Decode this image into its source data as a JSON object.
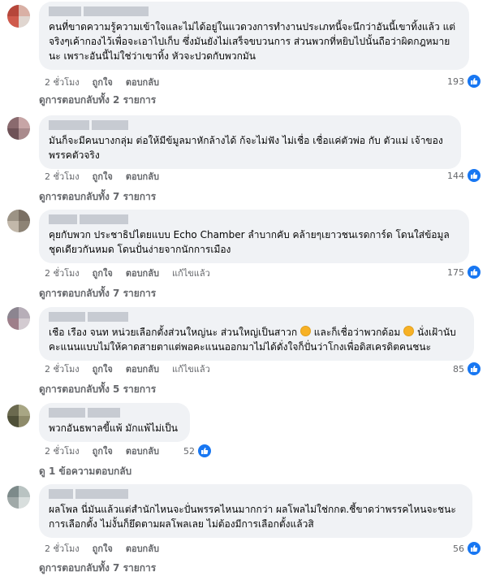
{
  "colors": {
    "accent": "#1877f2",
    "bubble": "#f0f2f5",
    "meta": "#65676b"
  },
  "comments": [
    {
      "text": "คนที่ขาดความรู้ความเข้าใจและไม่ได้อยู่ในแวดวงการทำงานประเภทนี้จะนึกว่าอันนี้เขาทิ้งแล้ว แต่จริงๆเค้ากองไว้เพื่อจะเอาไปเก็บ ซึ่งมันยังไม่เสร็จขบวนการ ส่วนพวกที่หยิบไปนั้นถือว่าผิดกฎหมายนะ เพราะอันนี้ไม่ใช่ว่าเขาทิ้ง หัวจะปวดกับพวกมัน",
      "time": "2 ชั่วโมง",
      "like": "ถูกใจ",
      "reply": "ตอบกลับ",
      "edited": "",
      "reactions": "193",
      "replies": "ดูการตอบกลับทั้ง 2 รายการ"
    },
    {
      "text": "มันก็จะมีคนบางกลุ่ม ต่อให้มีข้มูลมาหักล้างได้ ก้จะไม่ฟัง ไม่เชื่อ เชื่อแค่ตัวพ่อ กับ ตัวแม่ เจ้าของพรรคตัวจริง",
      "time": "2 ชั่วโมง",
      "like": "ถูกใจ",
      "reply": "ตอบกลับ",
      "edited": "",
      "reactions": "144",
      "replies": "ดูการตอบกลับทั้ง 7 รายการ"
    },
    {
      "text": "คุยกับพวก ประชาธิปไตยแบบ Echo Chamber ลำบากคับ คล้ายๆเยาวชนเรดการ์ด โดนใส่ข้อมูลชุดเดียวกันหมด โดนปั่นง่ายจากนักการเมือง",
      "time": "2 ชั่วโมง",
      "like": "ถูกใจ",
      "reply": "ตอบกลับ",
      "edited": "แก้ไขแล้ว",
      "reactions": "175",
      "replies": "ดูการตอบกลับทั้ง 7 รายการ"
    },
    {
      "text_a": "เชือ เรือง จนท หน่วยเลือกตั้งส่วนใหญ่นะ ส่วนใหญ่เป็นสาวก",
      "text_b": "และก็เชื่อว่าพวกด้อม",
      "text_c": "นั่งเฝ้านับคะแนนแบบไม่ให้คาดสายตาแต่พอคะแนนออกมาไม่ได้ดั่งใจก็ปั่นว่าโกงเพื่อดิสเครดิตคนชนะ",
      "time": "2 ชั่วโมง",
      "like": "ถูกใจ",
      "reply": "ตอบกลับ",
      "edited": "แก้ไขแล้ว",
      "reactions": "85",
      "replies": "ดูการตอบกลับทั้ง 5 รายการ"
    },
    {
      "text": "พวกอันธพาลขี้แพ้ มักแพ้ไม่เป็น",
      "time": "2 ชั่วโมง",
      "like": "ถูกใจ",
      "reply": "ตอบกลับ",
      "edited": "",
      "reactions": "52",
      "replies": "ดู 1 ข้อความตอบกลับ"
    },
    {
      "text": "ผลโพล นี่มันแล้วแต่สำนักไหนจะปั่นพรรคไหนมากกว่า ผลโพลไม่ใช่กกต.ชี้ขาดว่าพรรคไหนจะชนะการเลือกตั้ง ไม่งั้นก็ยึดตามผลโพลเลย ไม่ต้องมีการเลือกตั้งแล้วสิ",
      "time": "2 ชั่วโมง",
      "like": "ถูกใจ",
      "reply": "ตอบกลับ",
      "edited": "",
      "reactions": "56",
      "replies": "ดูการตอบกลับทั้ง 7 รายการ"
    }
  ]
}
